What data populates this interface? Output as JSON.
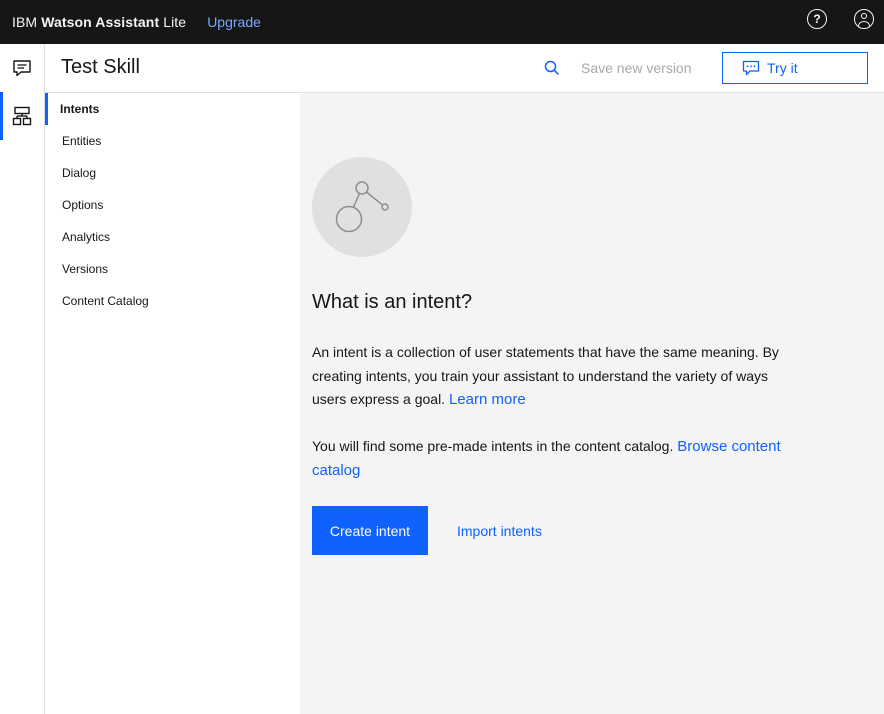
{
  "topbar": {
    "brand_prefix": "IBM ",
    "brand_bold": "Watson Assistant",
    "brand_suffix": " Lite",
    "upgrade_label": "Upgrade",
    "help_icon": "help-icon",
    "user_icon": "user-icon"
  },
  "rail": {
    "items": [
      {
        "icon": "chat-icon",
        "active": false
      },
      {
        "icon": "skills-icon",
        "active": true
      }
    ]
  },
  "header": {
    "title": "Test Skill",
    "save_version_label": "Save new version",
    "try_it_label": "Try it"
  },
  "nav": {
    "items": [
      {
        "label": "Intents",
        "active": true
      },
      {
        "label": "Entities",
        "active": false
      },
      {
        "label": "Dialog",
        "active": false
      },
      {
        "label": "Options",
        "active": false
      },
      {
        "label": "Analytics",
        "active": false
      },
      {
        "label": "Versions",
        "active": false
      },
      {
        "label": "Content Catalog",
        "active": false
      }
    ]
  },
  "main": {
    "heading": "What is an intent?",
    "para1_text": "An intent is a collection of user statements that have the same meaning. By creating intents, you train your assistant to understand the variety of ways users express a goal. ",
    "para1_link": "Learn more",
    "para2_text": "You will find some pre-made intents in the content catalog. ",
    "para2_link": "Browse content catalog",
    "create_label": "Create intent",
    "import_label": "Import intents"
  },
  "colors": {
    "topbar_bg": "#161616",
    "accent": "#0f62fe",
    "upgrade_link": "#78a9ff",
    "main_bg": "#f4f4f4"
  }
}
